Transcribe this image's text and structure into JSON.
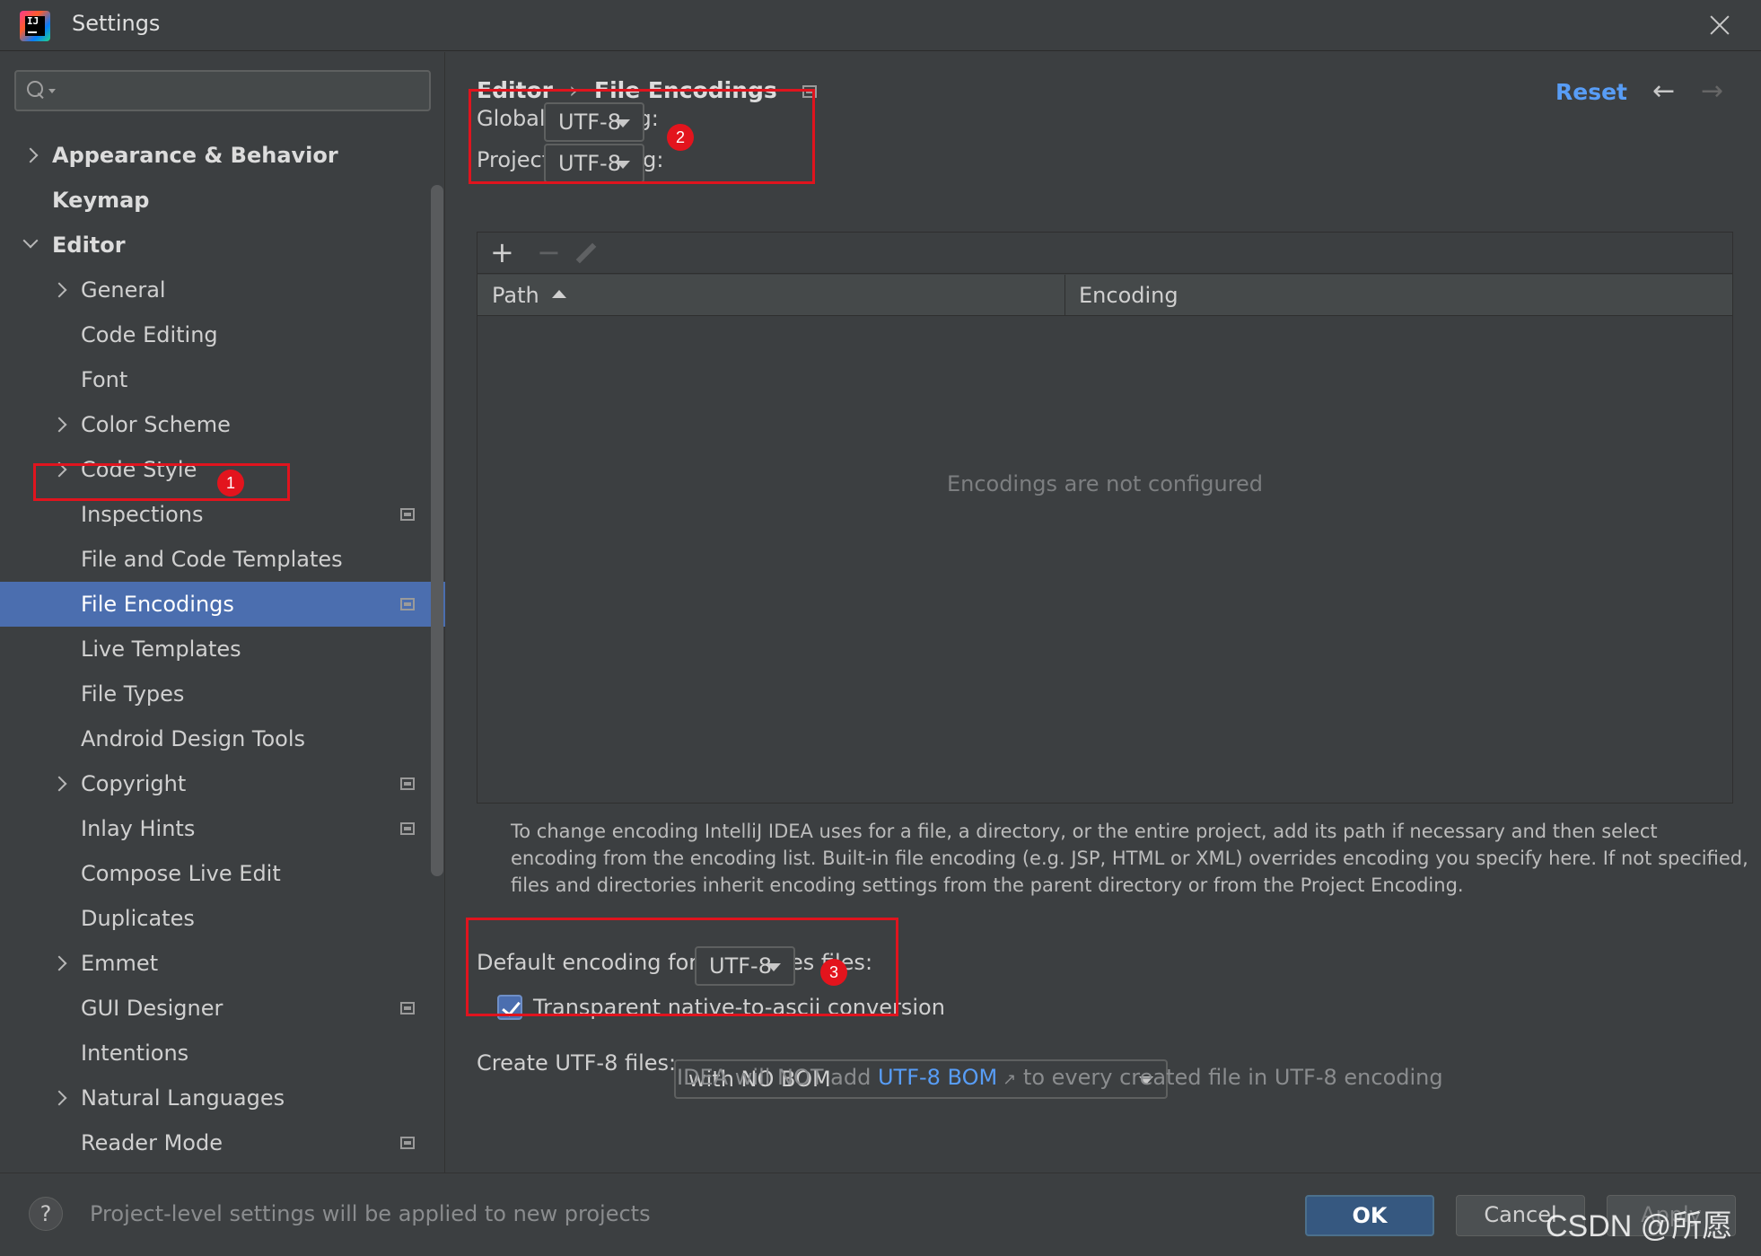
{
  "window": {
    "title": "Settings",
    "logo_text": "IJ"
  },
  "sidebar": {
    "search": {
      "value": "",
      "placeholder": ""
    },
    "items": [
      {
        "label": "Appearance & Behavior",
        "level": 0,
        "expander": "collapsed"
      },
      {
        "label": "Keymap",
        "level": 0,
        "expander": "none"
      },
      {
        "label": "Editor",
        "level": 0,
        "expander": "expanded"
      },
      {
        "label": "General",
        "level": 1,
        "expander": "collapsed"
      },
      {
        "label": "Code Editing",
        "level": 1,
        "expander": "none"
      },
      {
        "label": "Font",
        "level": 1,
        "expander": "none"
      },
      {
        "label": "Color Scheme",
        "level": 1,
        "expander": "collapsed"
      },
      {
        "label": "Code Style",
        "level": 1,
        "expander": "collapsed"
      },
      {
        "label": "Inspections",
        "level": 1,
        "expander": "none",
        "project_icon": true
      },
      {
        "label": "File and Code Templates",
        "level": 1,
        "expander": "none"
      },
      {
        "label": "File Encodings",
        "level": 1,
        "expander": "none",
        "project_icon": true,
        "selected": true
      },
      {
        "label": "Live Templates",
        "level": 1,
        "expander": "none"
      },
      {
        "label": "File Types",
        "level": 1,
        "expander": "none"
      },
      {
        "label": "Android Design Tools",
        "level": 1,
        "expander": "none"
      },
      {
        "label": "Copyright",
        "level": 1,
        "expander": "collapsed",
        "project_icon": true
      },
      {
        "label": "Inlay Hints",
        "level": 1,
        "expander": "none",
        "project_icon": true
      },
      {
        "label": "Compose Live Edit",
        "level": 1,
        "expander": "none"
      },
      {
        "label": "Duplicates",
        "level": 1,
        "expander": "none"
      },
      {
        "label": "Emmet",
        "level": 1,
        "expander": "collapsed"
      },
      {
        "label": "GUI Designer",
        "level": 1,
        "expander": "none",
        "project_icon": true
      },
      {
        "label": "Intentions",
        "level": 1,
        "expander": "none"
      },
      {
        "label": "Natural Languages",
        "level": 1,
        "expander": "collapsed"
      },
      {
        "label": "Reader Mode",
        "level": 1,
        "expander": "none",
        "project_icon": true
      }
    ]
  },
  "header": {
    "breadcrumb": [
      "Editor",
      "File Encodings"
    ],
    "separator": "›",
    "reset_label": "Reset",
    "back_arrow": "←",
    "forward_arrow": "→"
  },
  "encoding": {
    "global_label": "Global Encoding:",
    "global_value": "UTF-8",
    "project_label": "Project Encoding:",
    "project_value": "UTF-8"
  },
  "table": {
    "toolbar": {
      "add": "+",
      "remove": "−"
    },
    "columns": [
      "Path",
      "Encoding"
    ],
    "sorted_column": "Path",
    "sort_direction": "ascending",
    "rows": [],
    "empty_text": "Encodings are not configured"
  },
  "help_text": "To change encoding IntelliJ IDEA uses for a file, a directory, or the entire project, add its path if necessary and then select encoding from the encoding list. Built-in file encoding (e.g. JSP, HTML or XML) overrides encoding you specify here. If not specified, files and directories inherit encoding settings from the parent directory or from the Project Encoding.",
  "properties": {
    "label": "Default encoding for properties files:",
    "value": "UTF-8",
    "native_to_ascii_label": "Transparent native-to-ascii conversion",
    "native_to_ascii_checked": true
  },
  "bom": {
    "label": "Create UTF-8 files:",
    "value": "with NO BOM",
    "hint_before": "IDEA will NOT add ",
    "hint_link": "UTF-8 BOM",
    "hint_link_arrow": "↗",
    "hint_after": " to every created file in UTF-8 encoding"
  },
  "annotations": [
    "1",
    "2",
    "3"
  ],
  "footer": {
    "help_label": "?",
    "status": "Project-level settings will be applied to new projects",
    "ok_label": "OK",
    "cancel_label": "Cancel",
    "apply_label": "Apply"
  },
  "watermark": "CSDN @所愿",
  "colors": {
    "background": "#3c3f41",
    "selection": "#4b6eaf",
    "link": "#589df6",
    "annotation_red": "#e3141d",
    "ok_button": "#365880"
  },
  "icons": {
    "app": "intellij-idea-icon",
    "close": "close-icon",
    "search": "search-icon",
    "project_level": "project-level-icon"
  }
}
